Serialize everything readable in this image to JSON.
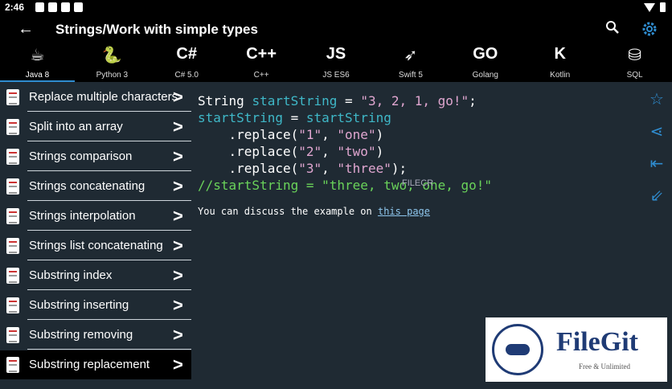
{
  "status": {
    "time": "2:46"
  },
  "appbar": {
    "title": "Strings/Work with simple types"
  },
  "languages": [
    {
      "label": "Java 8",
      "icon": "☕",
      "active": true
    },
    {
      "label": "Python 3",
      "icon": "🐍"
    },
    {
      "label": "C# 5.0",
      "icon": "C#"
    },
    {
      "label": "C++",
      "icon": "C++"
    },
    {
      "label": "JS ES6",
      "icon": "JS"
    },
    {
      "label": "Swift 5",
      "icon": "➶"
    },
    {
      "label": "Golang",
      "icon": "GO"
    },
    {
      "label": "Kotlin",
      "icon": "K"
    },
    {
      "label": "SQL",
      "icon": "⛁"
    }
  ],
  "sidebar": {
    "items": [
      {
        "label": "Replace multiple characters"
      },
      {
        "label": "Split into an array"
      },
      {
        "label": "Strings comparison"
      },
      {
        "label": "Strings concatenating"
      },
      {
        "label": "Strings interpolation"
      },
      {
        "label": "Strings list concatenating"
      },
      {
        "label": "Substring index"
      },
      {
        "label": "Substring inserting"
      },
      {
        "label": "Substring removing"
      },
      {
        "label": "Substring replacement"
      }
    ]
  },
  "code": {
    "l1a": "String ",
    "l1b": "startString",
    "l1c": " = ",
    "l1d": "\"3, 2, 1, go!\"",
    "l1e": ";",
    "l2a": "startString",
    "l2b": " = ",
    "l2c": "startString",
    "l3a": "    .replace(",
    "l3b": "\"1\"",
    "l3c": ", ",
    "l3d": "\"one\"",
    "l3e": ")",
    "l4a": "    .replace(",
    "l4b": "\"2\"",
    "l4c": ", ",
    "l4d": "\"two\"",
    "l4e": ")",
    "l5a": "    .replace(",
    "l5b": "\"3\"",
    "l5c": ", ",
    "l5d": "\"three\"",
    "l5e": ");",
    "l6": "//startString = \"three, two, one, go!\""
  },
  "discuss": {
    "prefix": "You can discuss the example on ",
    "link": "this page"
  },
  "watermark": {
    "text": "FILECR"
  },
  "logo": {
    "name": "FileGit",
    "tagline": "Free & Unlimited"
  }
}
